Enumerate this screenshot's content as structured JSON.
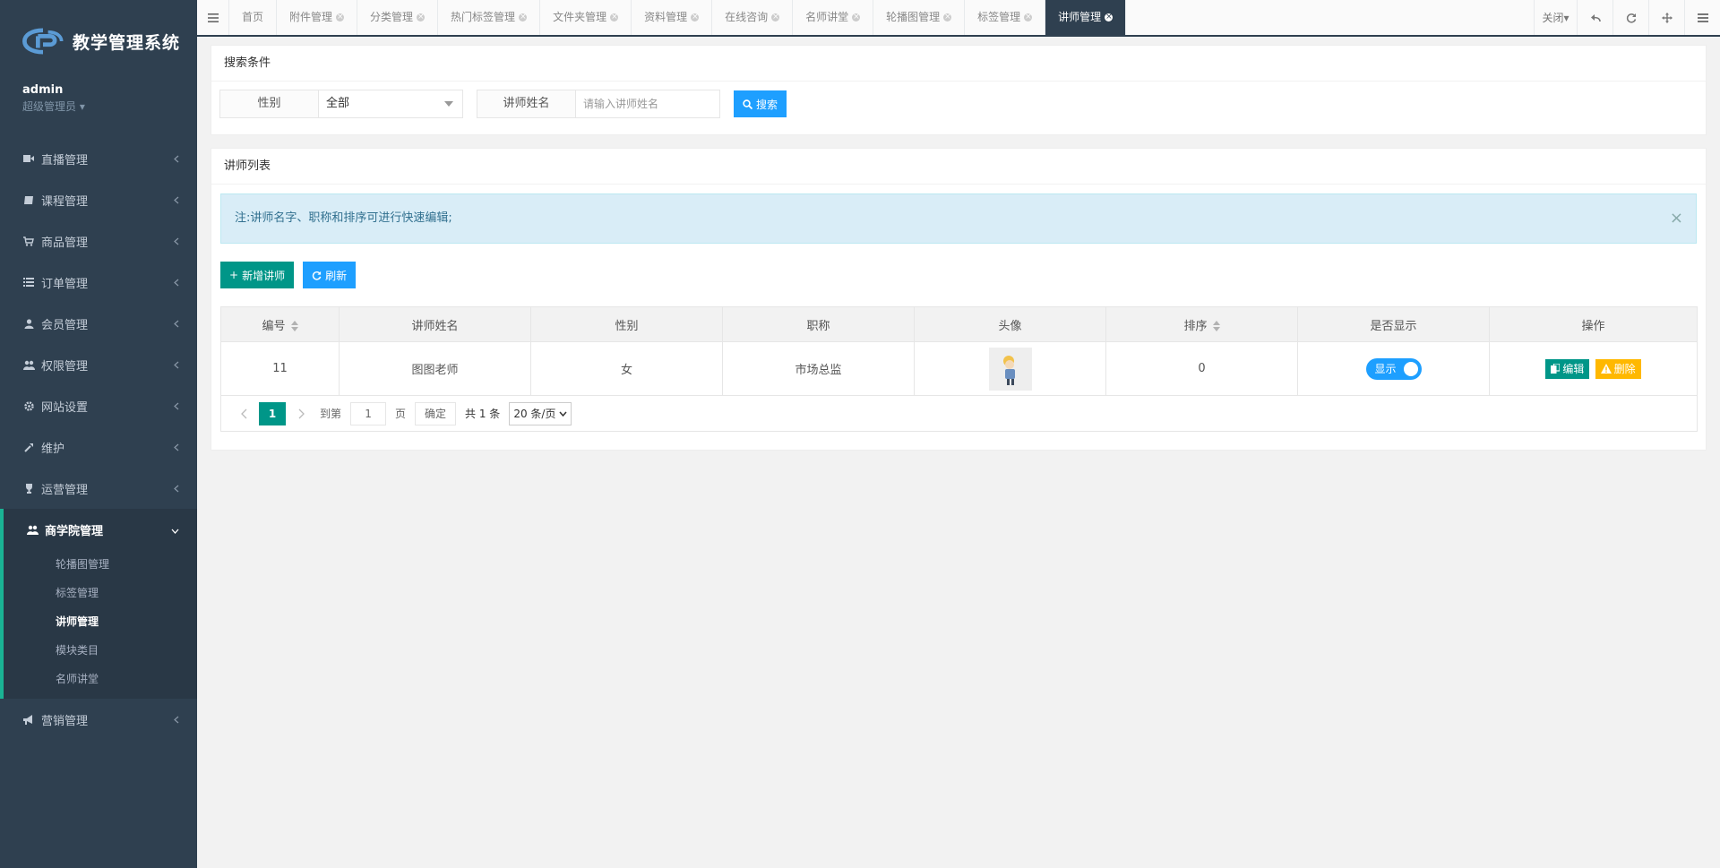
{
  "app": {
    "title": "教学管理系统"
  },
  "user": {
    "name": "admin",
    "role": "超级管理员"
  },
  "menu": [
    {
      "label": "直播管理",
      "icon": "video-icon"
    },
    {
      "label": "课程管理",
      "icon": "book-icon"
    },
    {
      "label": "商品管理",
      "icon": "cart-icon"
    },
    {
      "label": "订单管理",
      "icon": "list-icon"
    },
    {
      "label": "会员管理",
      "icon": "user-icon"
    },
    {
      "label": "权限管理",
      "icon": "users-icon"
    },
    {
      "label": "网站设置",
      "icon": "gear-icon"
    },
    {
      "label": "维护",
      "icon": "wrench-icon"
    },
    {
      "label": "运营管理",
      "icon": "trophy-icon"
    }
  ],
  "active_menu": {
    "label": "商学院管理",
    "icon": "users-icon",
    "children": [
      "轮播图管理",
      "标签管理",
      "讲师管理",
      "模块类目",
      "名师讲堂"
    ],
    "current": "讲师管理"
  },
  "menu_after": [
    {
      "label": "营销管理",
      "icon": "bullhorn-icon"
    }
  ],
  "tabs": [
    "首页",
    "附件管理",
    "分类管理",
    "热门标签管理",
    "文件夹管理",
    "资料管理",
    "在线咨询",
    "名师讲堂",
    "轮播图管理",
    "标签管理",
    "讲师管理"
  ],
  "active_tab": "讲师管理",
  "topbar": {
    "close_label": "关闭"
  },
  "search": {
    "title": "搜索条件",
    "gender_label": "性别",
    "gender_value": "全部",
    "name_label": "讲师姓名",
    "name_placeholder": "请输入讲师姓名",
    "search_button": "搜索"
  },
  "list": {
    "title": "讲师列表",
    "notice": "注:讲师名字、职称和排序可进行快速编辑;",
    "add_button": "新增讲师",
    "refresh_button": "刷新",
    "columns": [
      "编号",
      "讲师姓名",
      "性别",
      "职称",
      "头像",
      "排序",
      "是否显示",
      "操作"
    ],
    "rows": [
      {
        "id": "11",
        "name": "图图老师",
        "gender": "女",
        "title": "市场总监",
        "sort": "0",
        "display": "显示",
        "edit": "编辑",
        "delete": "删除"
      }
    ]
  },
  "pager": {
    "current": "1",
    "goto_label": "到第",
    "goto_value": "1",
    "page_unit": "页",
    "confirm": "确定",
    "total": "共 1 条",
    "page_size": "20 条/页"
  }
}
